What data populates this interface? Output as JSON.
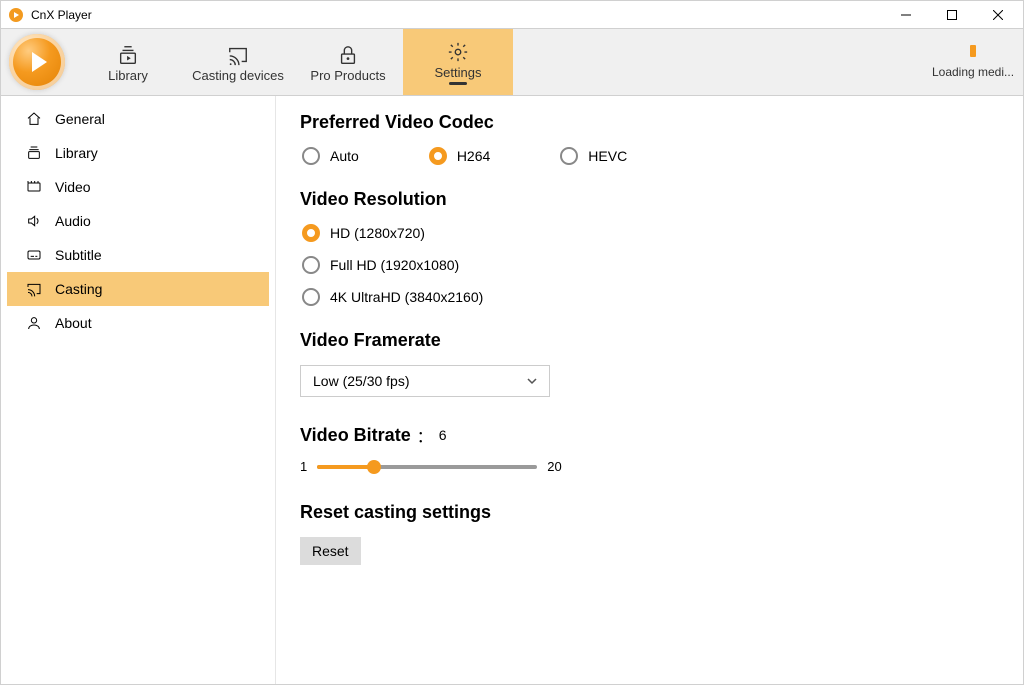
{
  "window": {
    "title": "CnX Player"
  },
  "toolbar": {
    "items": [
      {
        "label": "Library"
      },
      {
        "label": "Casting devices"
      },
      {
        "label": "Pro Products"
      },
      {
        "label": "Settings"
      }
    ],
    "loading_text": "Loading medi..."
  },
  "sidebar": {
    "items": [
      {
        "label": "General"
      },
      {
        "label": "Library"
      },
      {
        "label": "Video"
      },
      {
        "label": "Audio"
      },
      {
        "label": "Subtitle"
      },
      {
        "label": "Casting"
      },
      {
        "label": "About"
      }
    ],
    "selected": "Casting"
  },
  "sections": {
    "codec": {
      "title": "Preferred Video Codec",
      "options": [
        "Auto",
        "H264",
        "HEVC"
      ],
      "selected": "H264"
    },
    "resolution": {
      "title": "Video Resolution",
      "options": [
        "HD (1280x720)",
        "Full HD (1920x1080)",
        "4K UltraHD (3840x2160)"
      ],
      "selected": "HD (1280x720)"
    },
    "framerate": {
      "title": "Video Framerate",
      "selected": "Low (25/30 fps)"
    },
    "bitrate": {
      "title": "Video Bitrate",
      "separator": "：",
      "value": "6",
      "min": "1",
      "max": "20"
    },
    "reset": {
      "title": "Reset casting settings",
      "button": "Reset"
    }
  }
}
